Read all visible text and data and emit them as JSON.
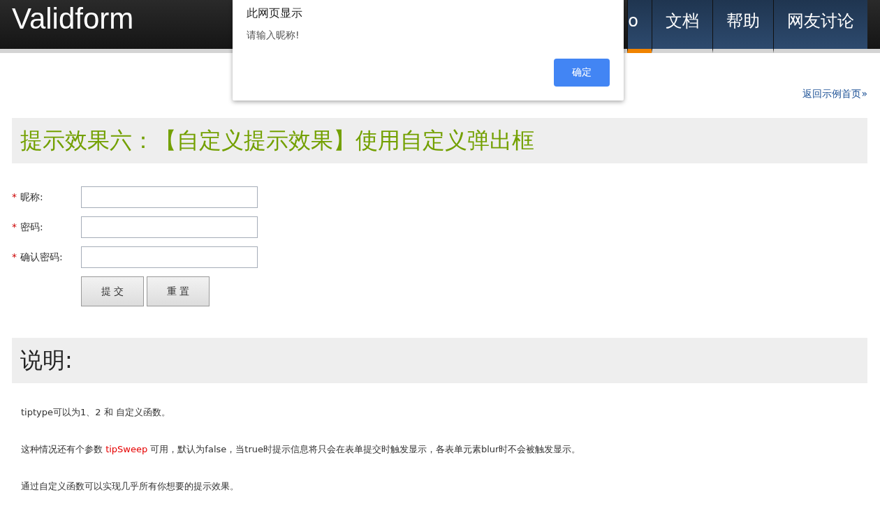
{
  "header": {
    "logo": "Validform",
    "nav": [
      {
        "label": "o",
        "selected": true
      },
      {
        "label": "文档",
        "selected": false
      },
      {
        "label": "帮助",
        "selected": false
      },
      {
        "label": "网友讨论",
        "selected": false
      }
    ]
  },
  "dialog": {
    "title": "此网页显示",
    "message": "请输入昵称!",
    "button": "确定"
  },
  "back_link": "返回示例首页»",
  "section_title": "提示效果六：【自定义提示效果】使用自定义弹出框",
  "form": {
    "fields": [
      {
        "required_mark": "*",
        "label": "昵称:"
      },
      {
        "required_mark": "*",
        "label": "密码:"
      },
      {
        "required_mark": "*",
        "label": "确认密码:"
      }
    ],
    "buttons": [
      "提 交",
      "重 置"
    ]
  },
  "notes_title": "说明:",
  "notes": [
    {
      "before": "tiptype可以为1、2 和 自定义函数。"
    },
    {
      "before": "这种情况还有个参数 ",
      "highlight": "tipSweep",
      "after": " 可用，默认为false，当true时提示信息将只会在表单提交时触发显示，各表单元素blur时不会被触发显示。"
    },
    {
      "before": "通过自定义函数可以实现几乎所有你想要的提示效果。"
    }
  ]
}
